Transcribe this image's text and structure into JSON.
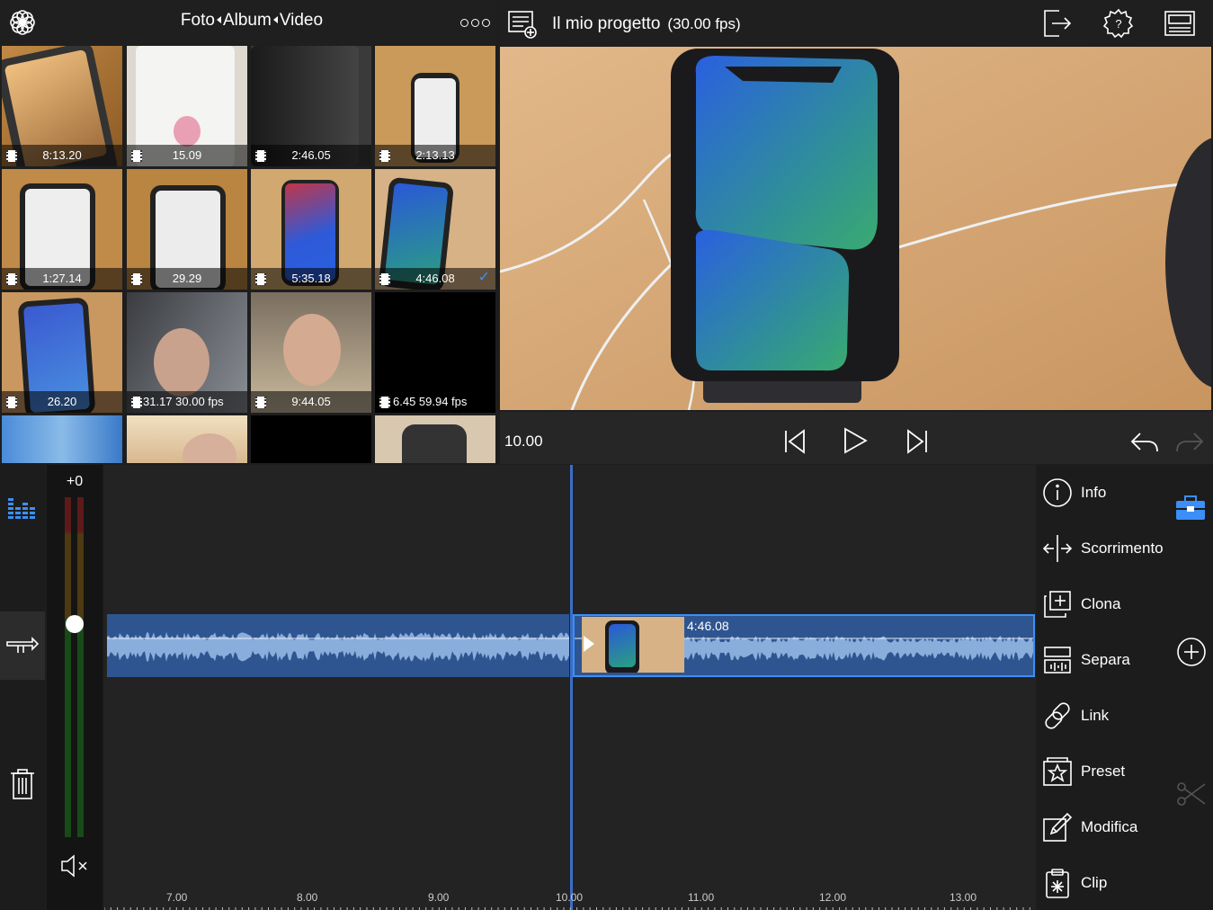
{
  "browser": {
    "nav": {
      "foto": "Foto",
      "album": "Album",
      "video": "Video"
    },
    "thumbnails": [
      {
        "duration": "8:13.20"
      },
      {
        "duration": "15.09"
      },
      {
        "duration": "2:46.05"
      },
      {
        "duration": "2:13.13"
      },
      {
        "duration": "1:27.14"
      },
      {
        "duration": "29.29"
      },
      {
        "duration": "5:35.18"
      },
      {
        "duration": "4:46.08",
        "selected": true
      },
      {
        "duration": "26.20"
      },
      {
        "duration": "31.17  30.00 fps"
      },
      {
        "duration": "9:44.05"
      },
      {
        "duration": "6.45  59.94 fps"
      }
    ]
  },
  "preview": {
    "title": "Il mio progetto",
    "fps": "(30.00 fps)",
    "time": "10.00"
  },
  "meter": {
    "level_label": "+0"
  },
  "timeline": {
    "clip_label": "4:46.08",
    "ruler": [
      "7.00",
      "8.00",
      "9.00",
      "10.00",
      "11.00",
      "12.00",
      "13.00"
    ]
  },
  "menu": {
    "info": "Info",
    "scorrimento": "Scorrimento",
    "clona": "Clona",
    "separa": "Separa",
    "link": "Link",
    "preset": "Preset",
    "modifica": "Modifica",
    "clip": "Clip"
  },
  "colors": {
    "accent": "#3b8ff6",
    "clip": "#2f5591",
    "wave": "#8aaedc"
  }
}
